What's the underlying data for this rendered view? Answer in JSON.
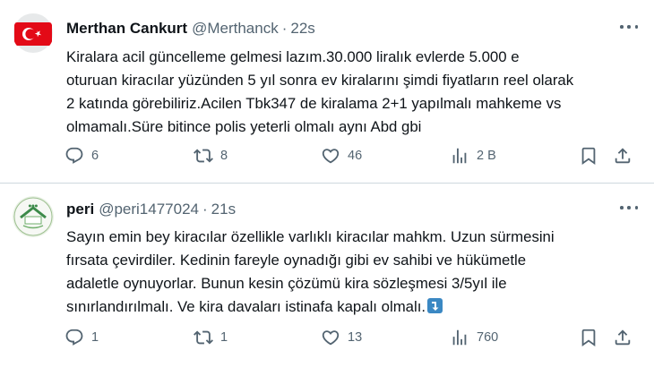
{
  "tweets": [
    {
      "name": "Merthan Cankurt",
      "handle": "@Merthanck",
      "separator": "·",
      "time": "22s",
      "avatar_icon": "turkey-flag",
      "lines": [
        "Kiralara acil güncelleme gelmesi lazım.30.000 liralık evlerde 5.000 e",
        "oturuan kiracılar yüzünden 5 yıl sonra ev kiralarını şimdi fiyatların reel olarak",
        "2 katında görebiliriz.Acilen Tbk347 de kiralama 2+1 yapılmalı mahkeme vs",
        "olmamalı.Süre bitince polis yeterli olmalı aynı Abd gbi"
      ],
      "actions": {
        "replies": "6",
        "reposts": "8",
        "likes": "46",
        "views": "2 B"
      }
    },
    {
      "name": "peri",
      "handle": "@peri1477024",
      "separator": "·",
      "time": "21s",
      "avatar_icon": "green-logo-avatar",
      "lines": [
        "Sayın emin bey kiracılar özellikle varlıklı kiracılar mahkm. Uzun sürmesini",
        "fırsata çevirdiler. Kedinin fareyle oynadığı gibi ev sahibi ve hükümetle",
        "adaletle oynuyorlar. Bunun kesin çözümü kira sözleşmesi 3/5yıl ile",
        "sınırlandırılmalı. Ve kira davaları istinafa kapalı olmalı."
      ],
      "trailing_emoji": "down-arrow-emoji",
      "actions": {
        "replies": "1",
        "reposts": "1",
        "likes": "13",
        "views": "760"
      }
    }
  ],
  "colors": {
    "text": "#0f1419",
    "muted": "#536471",
    "divider": "#cfd9de",
    "flag_red": "#e30a17",
    "emoji_blue": "#3b88c3"
  }
}
